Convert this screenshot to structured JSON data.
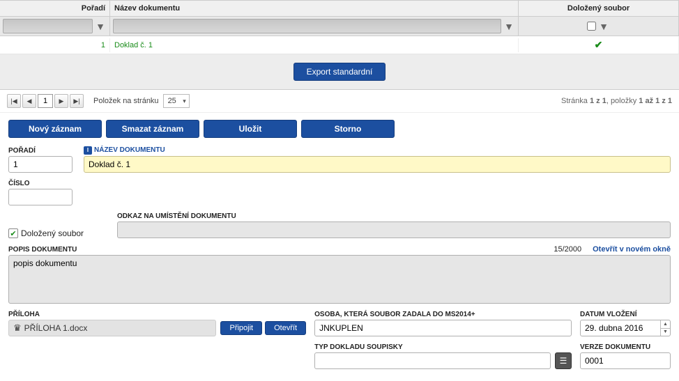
{
  "grid": {
    "headers": {
      "poradi": "Pořadí",
      "nazev": "Název dokumentu",
      "dolozeny": "Doložený soubor"
    },
    "rows": [
      {
        "poradi": "1",
        "nazev": "Doklad č. 1",
        "dolozeny": true
      }
    ],
    "export_button": "Export standardní"
  },
  "pager": {
    "first": "|◀",
    "prev": "◀",
    "next": "▶",
    "last": "▶|",
    "page": "1",
    "items_per_page_label": "Položek na stránku",
    "items_per_page": "25",
    "info_prefix": "Stránka ",
    "info_page": "1 z 1",
    "info_mid": ", položky ",
    "info_items": "1 až 1 z 1"
  },
  "toolbar": {
    "new": "Nový záznam",
    "delete": "Smazat záznam",
    "save": "Uložit",
    "cancel": "Storno"
  },
  "form": {
    "labels": {
      "poradi": "POŘADÍ",
      "nazev": "NÁZEV DOKUMENTU",
      "cislo": "ČÍSLO",
      "dolozeny": "Doložený soubor",
      "odkaz": "ODKAZ NA UMÍSTĚNÍ DOKUMENTU",
      "popis": "POPIS DOKUMENTU",
      "otevrit_okno": "Otevřít v novém okně",
      "priloha": "PŘÍLOHA",
      "pripojit": "Připojit",
      "otevrit": "Otevřít",
      "osoba": "OSOBA, KTERÁ SOUBOR ZADALA DO MS2014+",
      "datum": "DATUM VLOŽENÍ",
      "typ_dokladu": "TYP DOKLADU SOUPISKY",
      "verze": "VERZE DOKUMENTU"
    },
    "values": {
      "poradi": "1",
      "nazev": "Doklad č. 1",
      "cislo": "",
      "odkaz": "",
      "popis": "popis dokumentu",
      "popis_counter": "15/2000",
      "priloha_file": "PŘÍLOHA 1.docx",
      "osoba": "JNKUPLEN",
      "datum": "29. dubna 2016",
      "typ_dokladu": "",
      "verze": "0001"
    }
  }
}
